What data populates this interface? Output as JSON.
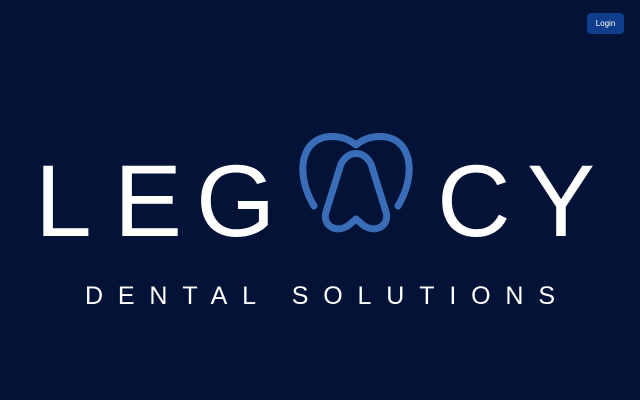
{
  "header": {
    "login_label": "Login"
  },
  "logo": {
    "letters_before": [
      "L",
      "E",
      "G"
    ],
    "letters_after": [
      "C",
      "Y"
    ],
    "tagline": "DENTAL SOLUTIONS",
    "tooth_icon": "tooth-a-icon",
    "colors": {
      "background": "#021337",
      "text": "#ffffff",
      "accent": "#3a6db8",
      "button": "#0f3d8c"
    }
  }
}
